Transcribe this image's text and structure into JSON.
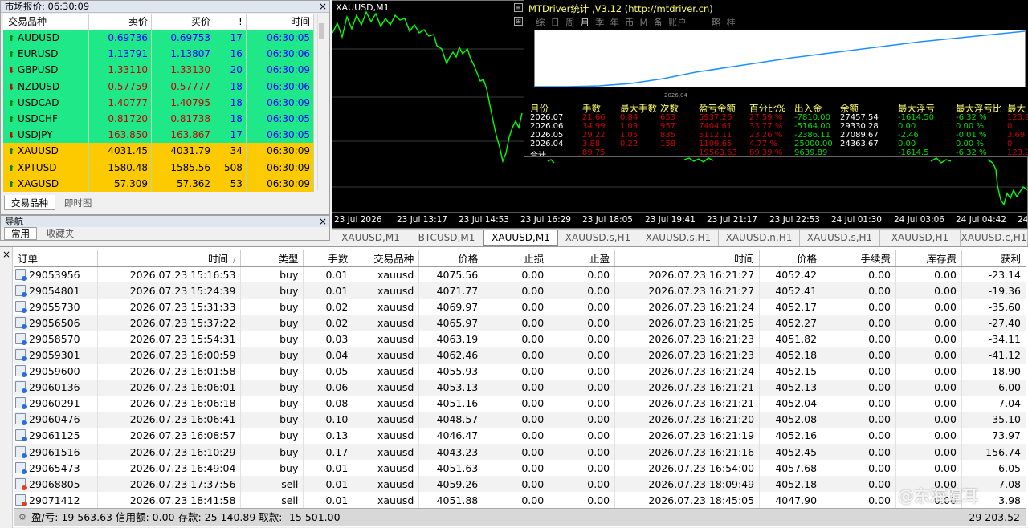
{
  "market_watch": {
    "title": "市场报价: 06:30:09",
    "columns": [
      "交易品种",
      "卖价",
      "买价",
      "!",
      "时间"
    ],
    "rows": [
      {
        "dir": "up",
        "symbol": "AUDUSD",
        "bid": "0.69736",
        "ask": "0.69753",
        "spread": "17",
        "time": "06:30:05",
        "color": "green",
        "bid_color": "blue"
      },
      {
        "dir": "up",
        "symbol": "EURUSD",
        "bid": "1.13791",
        "ask": "1.13807",
        "spread": "16",
        "time": "06:30:06",
        "color": "green",
        "bid_color": "blue"
      },
      {
        "dir": "dn",
        "symbol": "GBPUSD",
        "bid": "1.33110",
        "ask": "1.33130",
        "spread": "20",
        "time": "06:30:09",
        "color": "green",
        "bid_color": "red"
      },
      {
        "dir": "dn",
        "symbol": "NZDUSD",
        "bid": "0.57759",
        "ask": "0.57777",
        "spread": "18",
        "time": "06:30:06",
        "color": "green",
        "bid_color": "red"
      },
      {
        "dir": "up",
        "symbol": "USDCAD",
        "bid": "1.40777",
        "ask": "1.40795",
        "spread": "18",
        "time": "06:30:09",
        "color": "green",
        "bid_color": "red"
      },
      {
        "dir": "up",
        "symbol": "USDCHF",
        "bid": "0.81720",
        "ask": "0.81738",
        "spread": "18",
        "time": "06:30:05",
        "color": "green",
        "bid_color": "red"
      },
      {
        "dir": "dn",
        "symbol": "USDJPY",
        "bid": "163.850",
        "ask": "163.867",
        "spread": "17",
        "time": "06:30:05",
        "color": "green",
        "bid_color": "red"
      },
      {
        "dir": "up",
        "symbol": "XAUUSD",
        "bid": "4031.45",
        "ask": "4031.79",
        "spread": "34",
        "time": "06:30:09",
        "color": "gold",
        "bid_color": "black"
      },
      {
        "dir": "up",
        "symbol": "XPTUSD",
        "bid": "1580.48",
        "ask": "1585.56",
        "spread": "508",
        "time": "06:30:09",
        "color": "gold",
        "bid_color": "black"
      },
      {
        "dir": "up",
        "symbol": "XAGUSD",
        "bid": "57.309",
        "ask": "57.362",
        "spread": "53",
        "time": "06:30:09",
        "color": "gold",
        "bid_color": "black"
      }
    ],
    "tabs": [
      "交易品种",
      "即时图"
    ]
  },
  "navigator": {
    "title": "导航",
    "tabs": [
      "常用",
      "收藏夹"
    ]
  },
  "chart": {
    "label": "XAUUSD,M1",
    "time_labels": [
      "23 Jul 2026",
      "23 Jul 13:17",
      "23 Jul 14:53",
      "23 Jul 16:29",
      "23 Jul 18:05",
      "23 Jul 19:41",
      "23 Jul 21:17",
      "23 Jul 22:53",
      "24 Jul 01:30",
      "24 Jul 03:06",
      "24 Jul 04:42",
      "24"
    ],
    "tabs": [
      "XAUUSD,M1",
      "BTCUSD,M1",
      "XAUUSD,M1",
      "XAUUSD.s,H1",
      "XAUUSD.s,H1",
      "XAUUSD.n,H1",
      "XAUUSD.s,H1",
      "XAUUSD,H1",
      "XAUUSD.c,H1"
    ],
    "active_tab": 2
  },
  "mtdriver": {
    "title": "MTDriver统计 ,V3.12 (http://mtdriver.cn)",
    "tabs": [
      "综",
      "日",
      "周",
      "月",
      "季",
      "年",
      "币",
      "M",
      "备",
      "账户",
      "略",
      "桂"
    ],
    "axis_label": "2026.04",
    "headers": [
      "月份",
      "手数",
      "最大手数",
      "次数",
      "盈亏金额",
      "百分比%",
      "出入金",
      "余额",
      "最大浮亏",
      "最大浮亏比",
      "最大"
    ],
    "rows": [
      [
        "2026.07",
        "21.66",
        "0.84",
        "653",
        "5937.26",
        "27.59 %",
        "-7810.00",
        "27457.54",
        "-1614.50",
        "-6.32 %",
        "123.9"
      ],
      [
        "2026.06",
        "34.99",
        "1.09",
        "957",
        "7404.61",
        "33.77 %",
        "-5164.00",
        "29330.28",
        "0.00",
        "0.00 %",
        "0"
      ],
      [
        "2026.05",
        "29.22",
        "1.05",
        "835",
        "5112.11",
        "23.26 %",
        "-2386.11",
        "27089.67",
        "-2.46",
        "-0.01 %",
        "3.69"
      ],
      [
        "2026.04",
        "3.88",
        "0.22",
        "158",
        "1109.65",
        "4.77 %",
        "25000.00",
        "24363.67",
        "0.00",
        "0.00 %",
        "0"
      ],
      [
        "合计",
        "89.75",
        "",
        "",
        "19563.63",
        "89.39 %",
        "9639.89",
        "",
        "-1614.5",
        "-6.32 %",
        "123.9"
      ]
    ]
  },
  "orders": {
    "columns": [
      "订单",
      "时间",
      "类型",
      "手数",
      "交易品种",
      "价格",
      "止损",
      "止盈",
      "时间",
      "价格",
      "手续费",
      "库存费",
      "获利"
    ],
    "sort_marker": "/",
    "rows": [
      [
        "29053956",
        "2026.07.23 15:16:53",
        "buy",
        "0.01",
        "xauusd",
        "4075.56",
        "0.00",
        "0.00",
        "2026.07.23 16:21:27",
        "4052.42",
        "0.00",
        "0.00",
        "-23.14"
      ],
      [
        "29054801",
        "2026.07.23 15:24:39",
        "buy",
        "0.01",
        "xauusd",
        "4071.77",
        "0.00",
        "0.00",
        "2026.07.23 16:21:27",
        "4052.41",
        "0.00",
        "0.00",
        "-19.36"
      ],
      [
        "29055730",
        "2026.07.23 15:31:33",
        "buy",
        "0.02",
        "xauusd",
        "4069.97",
        "0.00",
        "0.00",
        "2026.07.23 16:21:24",
        "4052.17",
        "0.00",
        "0.00",
        "-35.60"
      ],
      [
        "29056506",
        "2026.07.23 15:37:22",
        "buy",
        "0.02",
        "xauusd",
        "4065.97",
        "0.00",
        "0.00",
        "2026.07.23 16:21:25",
        "4052.27",
        "0.00",
        "0.00",
        "-27.40"
      ],
      [
        "29058570",
        "2026.07.23 15:54:31",
        "buy",
        "0.03",
        "xauusd",
        "4063.19",
        "0.00",
        "0.00",
        "2026.07.23 16:21:23",
        "4051.82",
        "0.00",
        "0.00",
        "-34.11"
      ],
      [
        "29059301",
        "2026.07.23 16:00:59",
        "buy",
        "0.04",
        "xauusd",
        "4062.46",
        "0.00",
        "0.00",
        "2026.07.23 16:21:23",
        "4052.18",
        "0.00",
        "0.00",
        "-41.12"
      ],
      [
        "29059600",
        "2026.07.23 16:01:58",
        "buy",
        "0.05",
        "xauusd",
        "4055.93",
        "0.00",
        "0.00",
        "2026.07.23 16:21:24",
        "4052.15",
        "0.00",
        "0.00",
        "-18.90"
      ],
      [
        "29060136",
        "2026.07.23 16:06:01",
        "buy",
        "0.06",
        "xauusd",
        "4053.13",
        "0.00",
        "0.00",
        "2026.07.23 16:21:21",
        "4052.13",
        "0.00",
        "0.00",
        "-6.00"
      ],
      [
        "29060291",
        "2026.07.23 16:06:18",
        "buy",
        "0.08",
        "xauusd",
        "4051.16",
        "0.00",
        "0.00",
        "2026.07.23 16:21:21",
        "4052.04",
        "0.00",
        "0.00",
        "7.04"
      ],
      [
        "29060476",
        "2026.07.23 16:06:41",
        "buy",
        "0.10",
        "xauusd",
        "4048.57",
        "0.00",
        "0.00",
        "2026.07.23 16:21:20",
        "4052.08",
        "0.00",
        "0.00",
        "35.10"
      ],
      [
        "29061125",
        "2026.07.23 16:08:57",
        "buy",
        "0.13",
        "xauusd",
        "4046.47",
        "0.00",
        "0.00",
        "2026.07.23 16:21:19",
        "4052.16",
        "0.00",
        "0.00",
        "73.97"
      ],
      [
        "29061516",
        "2026.07.23 16:10:29",
        "buy",
        "0.17",
        "xauusd",
        "4043.23",
        "0.00",
        "0.00",
        "2026.07.23 16:21:16",
        "4052.45",
        "0.00",
        "0.00",
        "156.74"
      ],
      [
        "29065473",
        "2026.07.23 16:49:04",
        "buy",
        "0.01",
        "xauusd",
        "4051.63",
        "0.00",
        "0.00",
        "2026.07.23 16:54:00",
        "4057.68",
        "0.00",
        "0.00",
        "6.05"
      ],
      [
        "29068805",
        "2026.07.23 17:37:56",
        "sell",
        "0.01",
        "xauusd",
        "4059.26",
        "0.00",
        "0.00",
        "2026.07.23 18:09:49",
        "4052.18",
        "0.00",
        "0.00",
        "7.08"
      ],
      [
        "29071412",
        "2026.07.23 18:41:58",
        "sell",
        "0.01",
        "xauusd",
        "4051.88",
        "0.00",
        "0.00",
        "2026.07.23 18:45:05",
        "4047.90",
        "0.00",
        "0.00",
        "3.98"
      ]
    ],
    "summary": "盈/亏: 19 563.63  信用额: 0.00  存款: 25 140.89  取款: -15 501.00",
    "total": "29 203.52"
  },
  "watermark": "@东海瑄耳",
  "close_glyph": "×",
  "colors": {
    "mw_green": "#1fe889",
    "mw_gold": "#fdca00",
    "chart_line": "#00ff00",
    "mtd_title": "#ffff66"
  }
}
